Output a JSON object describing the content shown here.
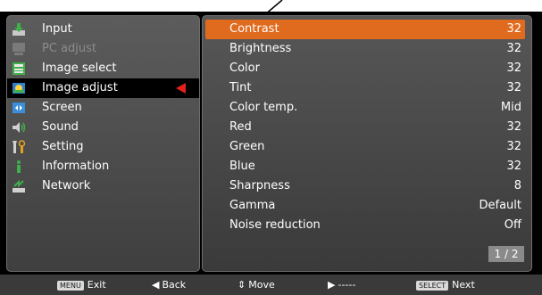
{
  "left_menu": {
    "items": [
      {
        "label": "Input",
        "icon": "input-icon",
        "state": "normal"
      },
      {
        "label": "PC adjust",
        "icon": "pc-adjust-icon",
        "state": "disabled"
      },
      {
        "label": "Image select",
        "icon": "image-select-icon",
        "state": "normal"
      },
      {
        "label": "Image adjust",
        "icon": "image-adjust-icon",
        "state": "selected"
      },
      {
        "label": "Screen",
        "icon": "screen-icon",
        "state": "normal"
      },
      {
        "label": "Sound",
        "icon": "sound-icon",
        "state": "normal"
      },
      {
        "label": "Setting",
        "icon": "setting-icon",
        "state": "normal"
      },
      {
        "label": "Information",
        "icon": "information-icon",
        "state": "normal"
      },
      {
        "label": "Network",
        "icon": "network-icon",
        "state": "normal"
      }
    ]
  },
  "settings": {
    "rows": [
      {
        "name": "Contrast",
        "value": "32"
      },
      {
        "name": "Brightness",
        "value": "32"
      },
      {
        "name": "Color",
        "value": "32"
      },
      {
        "name": "Tint",
        "value": "32"
      },
      {
        "name": "Color temp.",
        "value": "Mid"
      },
      {
        "name": "Red",
        "value": "32"
      },
      {
        "name": "Green",
        "value": "32"
      },
      {
        "name": "Blue",
        "value": "32"
      },
      {
        "name": "Sharpness",
        "value": "8"
      },
      {
        "name": "Gamma",
        "value": "Default"
      },
      {
        "name": "Noise reduction",
        "value": "Off"
      }
    ],
    "page": "1 / 2"
  },
  "bottom_bar": {
    "exit_key": "MENU",
    "exit_label": "Exit",
    "back_label": "Back",
    "move_label": "Move",
    "next_dash": "-----",
    "next_key": "SELECT",
    "next_label": "Next"
  },
  "colors": {
    "highlight": "#e06a1d",
    "selection_arrow": "#e2201c"
  }
}
